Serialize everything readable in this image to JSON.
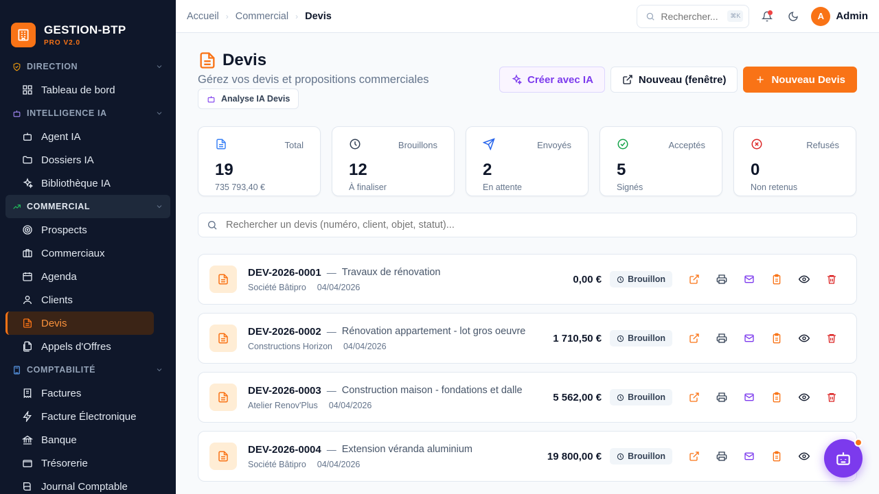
{
  "brand": {
    "title": "GESTION-BTP",
    "subtitle": "PRO V2.0"
  },
  "sidebar": {
    "sections": [
      {
        "label": "DIRECTION",
        "icon": "shield-icon",
        "items": [
          {
            "label": "Tableau de bord",
            "icon": "dashboard-icon"
          }
        ]
      },
      {
        "label": "INTELLIGENCE IA",
        "icon": "bot-icon",
        "items": [
          {
            "label": "Agent IA",
            "icon": "bot-icon"
          },
          {
            "label": "Dossiers IA",
            "icon": "folder-icon"
          },
          {
            "label": "Bibliothèque IA",
            "icon": "sparkles-icon"
          }
        ]
      },
      {
        "label": "COMMERCIAL",
        "icon": "trending-up-icon",
        "items": [
          {
            "label": "Prospects",
            "icon": "target-icon"
          },
          {
            "label": "Commerciaux",
            "icon": "briefcase-icon"
          },
          {
            "label": "Agenda",
            "icon": "calendar-icon"
          },
          {
            "label": "Clients",
            "icon": "user-icon"
          },
          {
            "label": "Devis",
            "icon": "file-text-icon"
          },
          {
            "label": "Appels d'Offres",
            "icon": "files-icon"
          }
        ]
      },
      {
        "label": "COMPTABILITÉ",
        "icon": "calculator-icon",
        "items": [
          {
            "label": "Factures",
            "icon": "receipt-icon"
          },
          {
            "label": "Facture Électronique",
            "icon": "zap-icon"
          },
          {
            "label": "Banque",
            "icon": "bank-icon"
          },
          {
            "label": "Trésorerie",
            "icon": "wallet-icon"
          },
          {
            "label": "Journal Comptable",
            "icon": "book-icon"
          }
        ]
      }
    ],
    "active_item": "Devis"
  },
  "topbar": {
    "breadcrumbs": [
      "Accueil",
      "Commercial",
      "Devis"
    ],
    "search_placeholder": "Rechercher...",
    "search_shortcut": "⌘K",
    "user_initial": "A",
    "user_name": "Admin"
  },
  "page": {
    "title": "Devis",
    "subtitle": "Gérez vos devis et propositions commerciales",
    "ai_analysis_label": "Analyse IA Devis",
    "actions": {
      "create_ai": "Créer avec IA",
      "new_window": "Nouveau (fenêtre)",
      "new_quote": "Nouveau Devis"
    }
  },
  "stats": [
    {
      "label": "Total",
      "value": "19",
      "sub": "735 793,40 €",
      "icon": "file-text-icon",
      "color": "#3b82f6"
    },
    {
      "label": "Brouillons",
      "value": "12",
      "sub": "À finaliser",
      "icon": "clock-icon",
      "color": "#334155"
    },
    {
      "label": "Envoyés",
      "value": "2",
      "sub": "En attente",
      "icon": "send-icon",
      "color": "#2563eb"
    },
    {
      "label": "Acceptés",
      "value": "5",
      "sub": "Signés",
      "icon": "check-circle-icon",
      "color": "#16a34a"
    },
    {
      "label": "Refusés",
      "value": "0",
      "sub": "Non retenus",
      "icon": "x-circle-icon",
      "color": "#dc2626"
    }
  ],
  "list_search_placeholder": "Rechercher un devis (numéro, client, objet, statut)...",
  "quotes": [
    {
      "number": "DEV-2026-0001",
      "object": "Travaux de rénovation",
      "client": "Société Bâtipro",
      "date": "04/04/2026",
      "amount": "0,00 €",
      "status": "Brouillon"
    },
    {
      "number": "DEV-2026-0002",
      "object": "Rénovation appartement - lot gros oeuvre",
      "client": "Constructions Horizon",
      "date": "04/04/2026",
      "amount": "1 710,50 €",
      "status": "Brouillon"
    },
    {
      "number": "DEV-2026-0003",
      "object": "Construction maison - fondations et dalle",
      "client": "Atelier Renov'Plus",
      "date": "04/04/2026",
      "amount": "5 562,00 €",
      "status": "Brouillon"
    },
    {
      "number": "DEV-2026-0004",
      "object": "Extension véranda aluminium",
      "client": "Société Bâtipro",
      "date": "04/04/2026",
      "amount": "19 800,00 €",
      "status": "Brouillon"
    }
  ],
  "colors": {
    "accent": "#f97316",
    "sidebar_bg": "#0f172a",
    "ai_purple": "#7c3aed",
    "danger": "#dc2626"
  }
}
